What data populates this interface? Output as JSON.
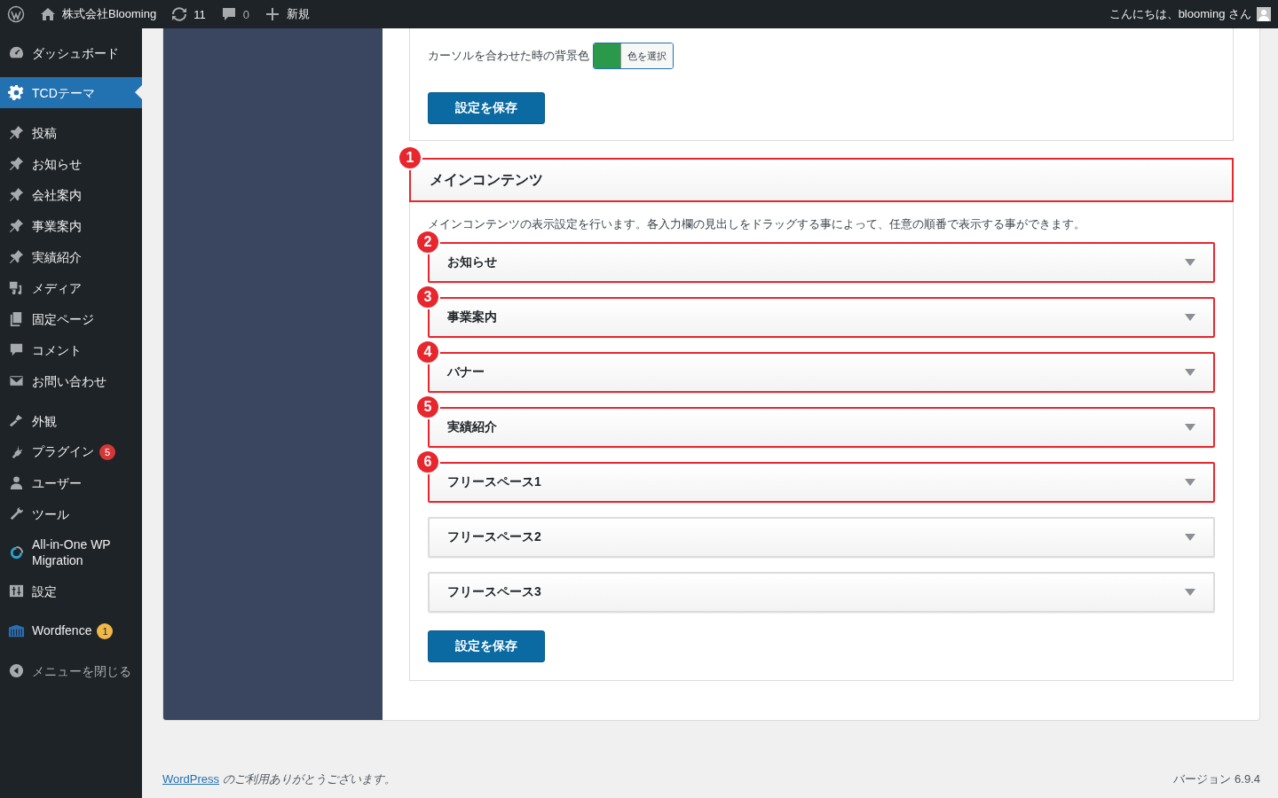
{
  "admin_bar": {
    "site_name": "株式会社Blooming",
    "updates": "11",
    "comments": "0",
    "new": "新規",
    "greeting": "こんにちは、blooming さん"
  },
  "sidebar": {
    "groups": [
      [
        {
          "label": "ダッシュボード",
          "selected": false
        }
      ],
      [
        {
          "label": "TCDテーマ",
          "selected": true
        }
      ],
      [
        {
          "label": "投稿",
          "selected": false
        },
        {
          "label": "お知らせ",
          "selected": false
        },
        {
          "label": "会社案内",
          "selected": false
        },
        {
          "label": "事業案内",
          "selected": false
        },
        {
          "label": "実績紹介",
          "selected": false
        },
        {
          "label": "メディア",
          "selected": false
        },
        {
          "label": "固定ページ",
          "selected": false
        },
        {
          "label": "コメント",
          "selected": false
        },
        {
          "label": "お問い合わせ",
          "selected": false
        }
      ],
      [
        {
          "label": "外観",
          "selected": false
        },
        {
          "label": "プラグイン",
          "selected": false,
          "badge": "5",
          "color": "#d63638"
        },
        {
          "label": "ユーザー",
          "selected": false
        },
        {
          "label": "ツール",
          "selected": false
        },
        {
          "label": "All-in-One WP Migration",
          "selected": false
        },
        {
          "label": "設定",
          "selected": false
        }
      ],
      [
        {
          "label": "Wordfence",
          "selected": false,
          "badge": "1",
          "color": "#f0b849"
        }
      ]
    ],
    "collapse": "メニューを閉じる"
  },
  "settings": {
    "hover_bg_label": "カーソルを合わせた時の背景色",
    "swatch": {
      "color": "#2a9a4a"
    },
    "color_button": "色を選択",
    "save": "設定を保存"
  },
  "main_contents": {
    "title": "メインコンテンツ",
    "callout": "1",
    "description": "メインコンテンツの表示設定を行います。各入力欄の見出しをドラッグする事によって、任意の順番で表示する事ができます。",
    "sections": [
      {
        "label": "お知らせ",
        "callout": "2"
      },
      {
        "label": "事業案内",
        "callout": "3"
      },
      {
        "label": "バナー",
        "callout": "4"
      },
      {
        "label": "実績紹介",
        "callout": "5"
      },
      {
        "label": "フリースペース1",
        "callout": "6"
      },
      {
        "label": "フリースペース2"
      },
      {
        "label": "フリースペース3"
      }
    ],
    "save": "設定を保存"
  },
  "footer": {
    "link": "WordPress",
    "thanks": "のご利用ありがとうございます。",
    "version": "バージョン 6.9.4"
  }
}
